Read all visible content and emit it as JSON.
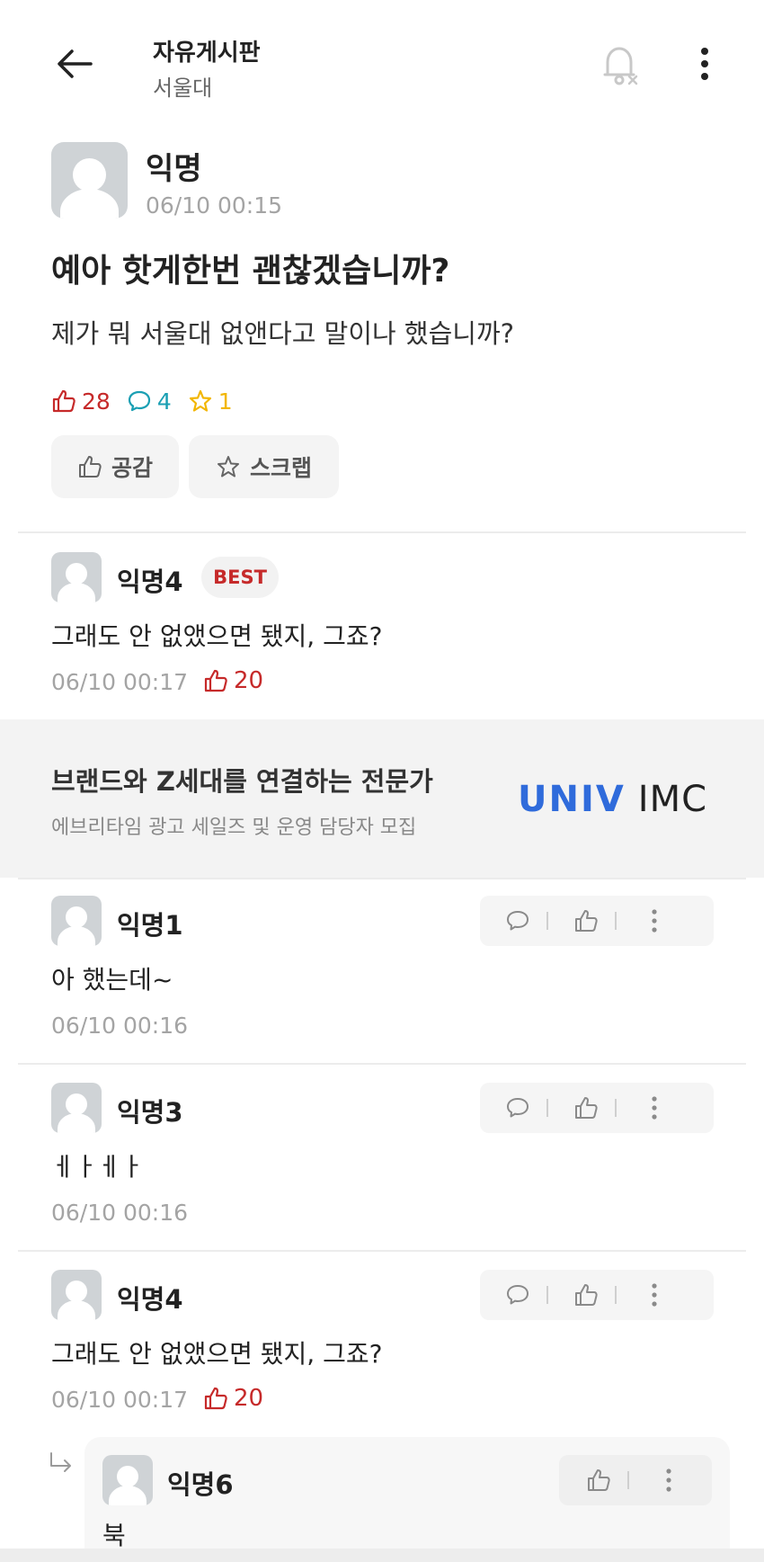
{
  "header": {
    "title": "자유게시판",
    "subtitle": "서울대"
  },
  "post": {
    "author": "익명",
    "time": "06/10 00:15",
    "title": "예아 핫게한번 괜찮겠습니까?",
    "body": "제가 뭐 서울대 없앤다고 말이나 했습니까?",
    "likes": "28",
    "comments": "4",
    "scraps": "1",
    "like_button": "공감",
    "scrap_button": "스크랩"
  },
  "best_comment": {
    "author": "익명4",
    "badge": "BEST",
    "text": "그래도 안 없앴으면 됐지, 그죠?",
    "time": "06/10 00:17",
    "likes": "20"
  },
  "ad": {
    "title": "브랜드와 Z세대를 연결하는 전문가",
    "subtitle": "에브리타임 광고 세일즈 및 운영 담당자 모집",
    "logo_part1": "UNIV",
    "logo_part2": "IMC"
  },
  "comments": [
    {
      "author": "익명1",
      "text": "아 했는데~",
      "time": "06/10 00:16"
    },
    {
      "author": "익명3",
      "text": "ㅔㅏㅔㅏ",
      "time": "06/10 00:16"
    },
    {
      "author": "익명4",
      "text": "그래도 안 없앴으면 됐지, 그죠?",
      "time": "06/10 00:17",
      "likes": "20"
    }
  ],
  "reply": {
    "author": "익명6",
    "text": "북"
  },
  "colors": {
    "like_red": "#c62a2a",
    "comment_teal": "#1a9fb3",
    "scrap_yellow": "#f2b600",
    "univ_blue": "#2f6bdb"
  }
}
